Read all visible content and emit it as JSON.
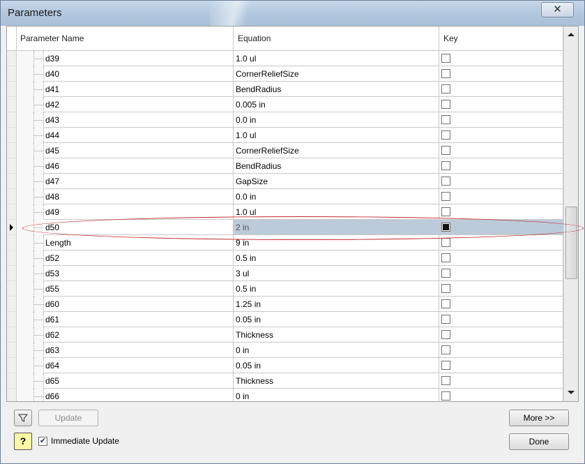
{
  "window": {
    "title": "Parameters",
    "close_glyph": "✕"
  },
  "columns": {
    "name": "Parameter Name",
    "equation": "Equation",
    "key": "Key"
  },
  "rows": [
    {
      "name": "d39",
      "equation": "1.0 ul",
      "key": false
    },
    {
      "name": "d40",
      "equation": "CornerReliefSize",
      "key": false
    },
    {
      "name": "d41",
      "equation": "BendRadius",
      "key": false
    },
    {
      "name": "d42",
      "equation": "0.005 in",
      "key": false
    },
    {
      "name": "d43",
      "equation": "0.0 in",
      "key": false
    },
    {
      "name": "d44",
      "equation": "1.0 ul",
      "key": false
    },
    {
      "name": "d45",
      "equation": "CornerReliefSize",
      "key": false
    },
    {
      "name": "d46",
      "equation": "BendRadius",
      "key": false
    },
    {
      "name": "d47",
      "equation": "GapSize",
      "key": false
    },
    {
      "name": "d48",
      "equation": "0.0 in",
      "key": false
    },
    {
      "name": "d49",
      "equation": "1.0 ul",
      "key": false
    },
    {
      "name": "d50",
      "equation": "2 in",
      "key": true,
      "active": true
    },
    {
      "name": "Length",
      "equation": "9 in",
      "key": false
    },
    {
      "name": "d52",
      "equation": "0.5 in",
      "key": false
    },
    {
      "name": "d53",
      "equation": "3 ul",
      "key": false
    },
    {
      "name": "d55",
      "equation": "0.5 in",
      "key": false
    },
    {
      "name": "d60",
      "equation": "1.25 in",
      "key": false
    },
    {
      "name": "d61",
      "equation": "0.05 in",
      "key": false
    },
    {
      "name": "d62",
      "equation": "Thickness",
      "key": false
    },
    {
      "name": "d63",
      "equation": "0 in",
      "key": false
    },
    {
      "name": "d64",
      "equation": "0.05 in",
      "key": false
    },
    {
      "name": "d65",
      "equation": "Thickness",
      "key": false
    },
    {
      "name": "d66",
      "equation": "0 in",
      "key": false
    }
  ],
  "footer": {
    "filter_icon": "filter-icon",
    "update_label": "Update",
    "help_glyph": "?",
    "immediate_update_label": "Immediate Update",
    "immediate_update_checked": true,
    "more_label": "More >>",
    "done_label": "Done"
  }
}
